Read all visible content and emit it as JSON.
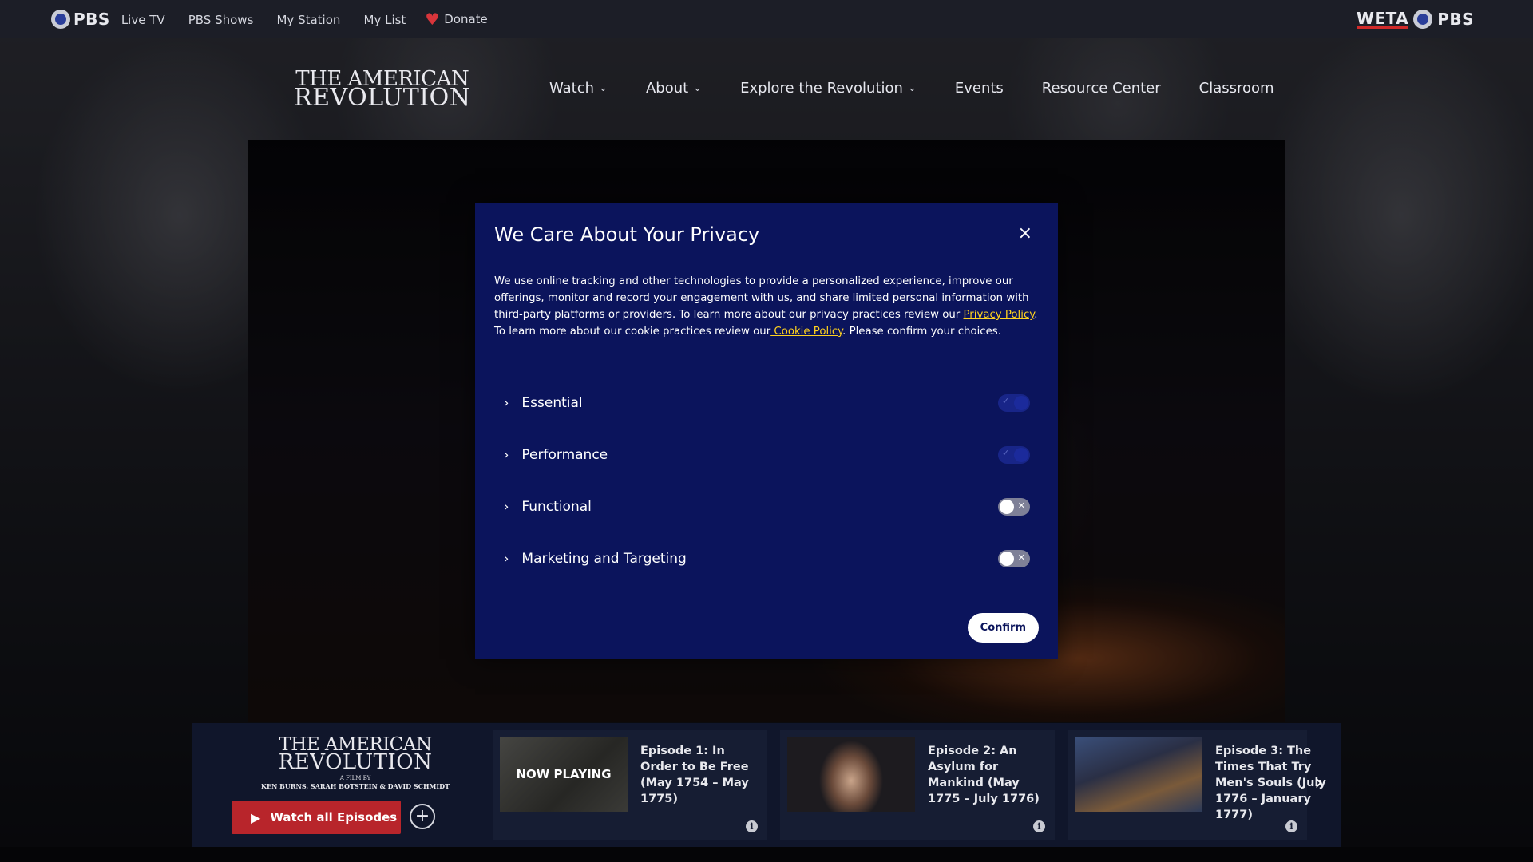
{
  "topbar": {
    "pbs_logo": "PBS",
    "nav": [
      "Live TV",
      "PBS Shows",
      "My Station",
      "My List"
    ],
    "donate_label": "Donate",
    "station_logo": "WETA",
    "station_pbs": "PBS"
  },
  "header": {
    "logo_line1": "THE AMERICAN",
    "logo_line2": "REVOLUTION",
    "nav": [
      {
        "label": "Watch",
        "dropdown": true
      },
      {
        "label": "About",
        "dropdown": true
      },
      {
        "label": "Explore the Revolution",
        "dropdown": true
      },
      {
        "label": "Events",
        "dropdown": false
      },
      {
        "label": "Resource Center",
        "dropdown": false
      },
      {
        "label": "Classroom",
        "dropdown": false
      }
    ]
  },
  "modal": {
    "title": "We Care About Your Privacy",
    "close_label": "×",
    "desc_part1": "We use online tracking and other technologies to provide a personalized experience, improve our offerings, monitor and record your engagement with us, and share limited personal information with third-party platforms or providers. To learn more about our privacy practices review our ",
    "privacy_link": "Privacy Policy",
    "desc_part2": ". To learn more about our cookie practices review our",
    "cookie_link": " Cookie Policy",
    "desc_part3": ". Please confirm your choices.",
    "preferences": [
      {
        "label": "Essential",
        "state": "on-locked"
      },
      {
        "label": "Performance",
        "state": "on-locked"
      },
      {
        "label": "Functional",
        "state": "off"
      },
      {
        "label": "Marketing and Targeting",
        "state": "off"
      }
    ],
    "confirm_label": "Confirm"
  },
  "bottom": {
    "logo_line1": "THE AMERICAN",
    "logo_line2": "REVOLUTION",
    "logo_line3": "A FILM BY",
    "logo_line4": "KEN BURNS, SARAH BOTSTEIN & DAVID SCHMIDT",
    "watch_all_label": "Watch all Episodes",
    "add_label": "+",
    "episodes": [
      {
        "title": "Episode 1: In Order to Be Free (May 1754 – May 1775)",
        "badge": "NOW PLAYING"
      },
      {
        "title": "Episode 2: An Asylum for Mankind (May 1775 – July 1776)",
        "badge": ""
      },
      {
        "title": "Episode 3: The Times That Try Men's Souls (July 1776 – January 1777)",
        "badge": ""
      }
    ],
    "next_label": "›"
  },
  "colors": {
    "modal_bg": "#0b145c",
    "link": "#ffd21f",
    "watch_button": "#b8252b",
    "topbar_bg": "#1c1e27"
  }
}
